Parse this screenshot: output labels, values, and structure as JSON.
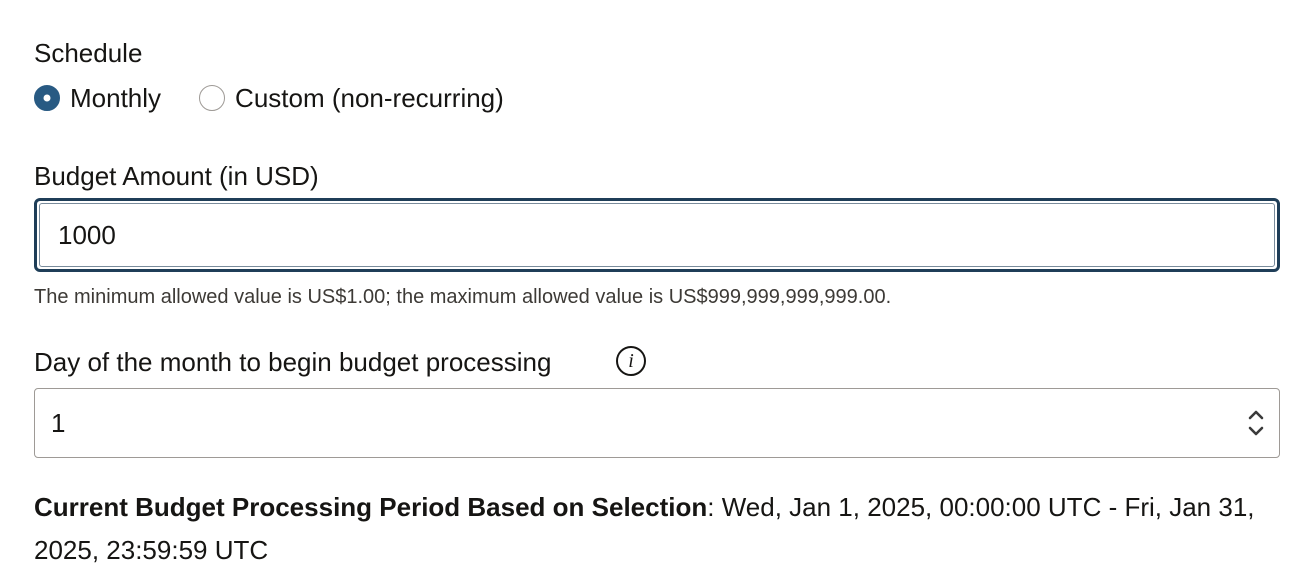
{
  "schedule": {
    "label": "Schedule",
    "options": [
      {
        "label": "Monthly",
        "selected": true
      },
      {
        "label": "Custom (non-recurring)",
        "selected": false
      }
    ]
  },
  "budget": {
    "label": "Budget Amount (in USD)",
    "value": "1000",
    "help_text": "The minimum allowed value is US$1.00; the maximum allowed value is US$999,999,999,999.00."
  },
  "day_of_month": {
    "label": "Day of the month to begin budget processing",
    "info_icon": "info-icon",
    "value": "1"
  },
  "period": {
    "label": "Current Budget Processing Period Based on Selection",
    "separator": ": ",
    "value": "Wed, Jan 1, 2025, 00:00:00 UTC - Fri, Jan 31, 2025, 23:59:59 UTC"
  },
  "colors": {
    "accent": "#285a83",
    "focus_border": "#1f3e58",
    "text": "#161513"
  }
}
